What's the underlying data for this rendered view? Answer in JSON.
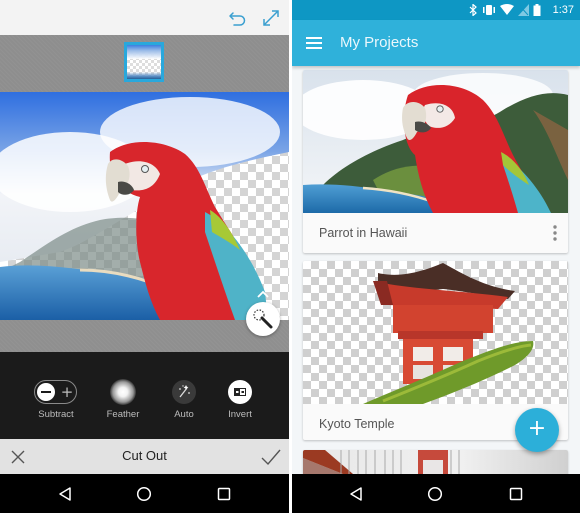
{
  "left_screen": {
    "topbar": {
      "undo_icon": "undo-icon",
      "expand_icon": "expand-icon"
    },
    "layer_thumbnail": {
      "selected": true
    },
    "canvas": {
      "subject": "Red macaw over Hawaiian coast, background partially erased"
    },
    "magic_wand_button": {
      "icon": "magic-wand-icon",
      "expand_icon": "chevron-up-icon"
    },
    "tools": [
      {
        "label": "Subtract",
        "icon": "subtract-add-toggle",
        "state": "subtract"
      },
      {
        "label": "Feather",
        "icon": "feather-brush-icon"
      },
      {
        "label": "Auto",
        "icon": "auto-magic-icon"
      },
      {
        "label": "Invert",
        "icon": "invert-icon"
      }
    ],
    "actionbar": {
      "title": "Cut Out",
      "cancel_icon": "close-icon",
      "confirm_icon": "check-icon"
    },
    "navbar": [
      "back",
      "home",
      "recents"
    ]
  },
  "right_screen": {
    "statusbar": {
      "icons": [
        "bluetooth",
        "vibrate",
        "wifi",
        "no-signal",
        "battery"
      ],
      "time": "1:37"
    },
    "appbar": {
      "menu_icon": "hamburger-menu-icon",
      "title": "My Projects"
    },
    "projects": [
      {
        "name": "Parrot in Hawaii",
        "has_menu": true
      },
      {
        "name": "Kyoto Temple",
        "has_menu": false
      },
      {
        "name": "",
        "has_menu": false
      }
    ],
    "fab": {
      "label": "+",
      "icon": "add-icon"
    },
    "navbar": [
      "back",
      "home",
      "recents"
    ]
  },
  "colors": {
    "accent": "#2fb1da",
    "statusbar": "#0e97c4",
    "tool_panel": "#1b1b1b",
    "selection_border": "#29a8dc"
  }
}
